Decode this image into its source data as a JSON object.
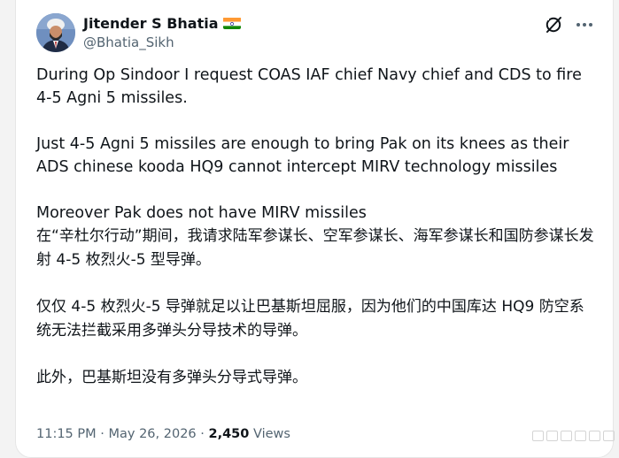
{
  "author": {
    "display_name": "Jitender S Bhatia",
    "handle": "@Bhatia_Sikh",
    "avatar_icon": "avatar-photo",
    "flag_icon": "india-flag-icon"
  },
  "header_actions": {
    "grok_icon": "grok-icon",
    "more_icon": "more-options-icon"
  },
  "tweet": {
    "paragraphs_en": [
      "During Op Sindoor I request COAS IAF chief Navy chief and CDS to fire 4-5 Agni 5 missiles.",
      "Just 4-5 Agni 5 missiles are enough to bring Pak on its knees as their ADS  chinese kooda HQ9 cannot intercept MIRV technology missiles",
      "Moreover Pak does not have MIRV missiles"
    ],
    "paragraphs_zh": [
      "在“辛杜尔行动”期间，我请求陆军参谋长、空军参谋长、海军参谋长和国防参谋长发射 4-5 枚烈火-5 型导弹。",
      "仅仅 4-5 枚烈火-5 导弹就足以让巴基斯坦屈服，因为他们的中国库达 HQ9 防空系统无法拦截采用多弹头分导技术的导弹。",
      "此外，巴基斯坦没有多弹头分导式导弹。"
    ]
  },
  "meta": {
    "time": "11:15 PM",
    "separator": " · ",
    "date": "May 26, 2026",
    "views_count": "2,450",
    "views_label": "Views"
  },
  "colors": {
    "text_primary": "#0f1419",
    "text_secondary": "#536471",
    "background": "#ffffff"
  }
}
